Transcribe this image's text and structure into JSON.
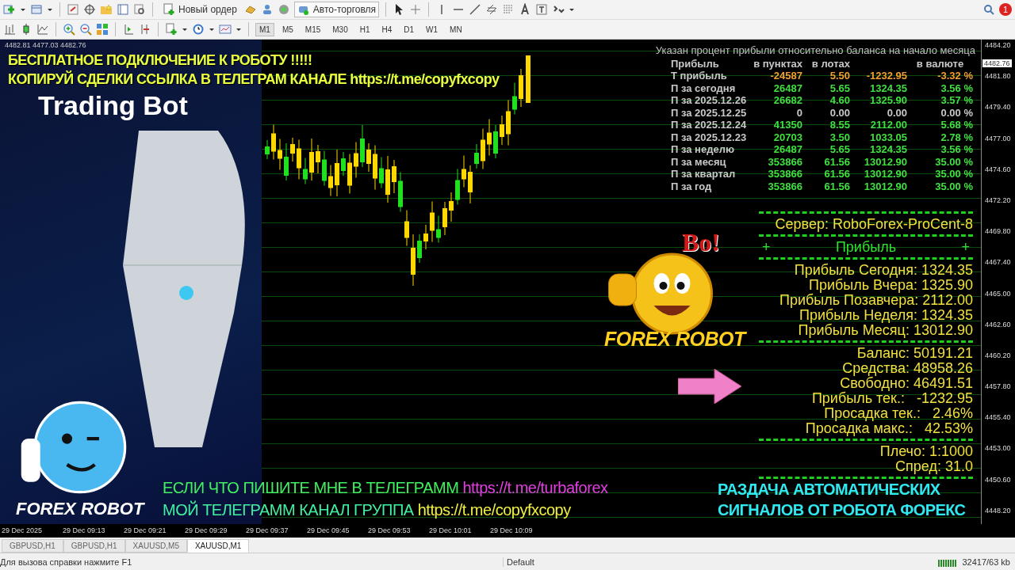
{
  "toolbar": {
    "new_order": "Новый ордер",
    "auto_trading": "Авто-торговля",
    "notifications": "1"
  },
  "periods": [
    {
      "label": "M1",
      "selected": true
    },
    {
      "label": "M5",
      "selected": false
    },
    {
      "label": "M15",
      "selected": false
    },
    {
      "label": "M30",
      "selected": false
    },
    {
      "label": "H1",
      "selected": false
    },
    {
      "label": "H4",
      "selected": false
    },
    {
      "label": "D1",
      "selected": false
    },
    {
      "label": "W1",
      "selected": false
    },
    {
      "label": "MN",
      "selected": false
    }
  ],
  "chart": {
    "ohlc": "4482.81 4477.03 4482.76",
    "banner": [
      "БЕСПЛАТНОЕ ПОДКЛЮЧЕНИЕ К РОБОТУ !!!!!",
      "КОПИРУЙ СДЕЛКИ ССЫЛКА В ТЕЛЕГРАМ КАНАЛЕ https://t.me/copyfxcopy"
    ],
    "picture_title": "Trading Bot",
    "picture_caption": "FOREX ROBOT",
    "sticker": {
      "exclaim": "Bo!",
      "caption": "FOREX ROBOT"
    },
    "profit_table": {
      "note": "Указан процент прибыли относительно баланса на начало месяца",
      "header": {
        "name": "Прибыль",
        "points": "в пунктах",
        "lots": "в лотах",
        "currency": "в валюте"
      },
      "rows": [
        {
          "name": "Т прибыль",
          "points": "-24587",
          "lots": "5.50",
          "money": "-1232.95",
          "percent": "-3.32 %",
          "color": "#f0a030"
        },
        {
          "name": "П за сегодня",
          "points": "26487",
          "lots": "5.65",
          "money": "1324.35",
          "percent": "3.56 %",
          "color": "#40e040"
        },
        {
          "name": "П за 2025.12.26",
          "points": "26682",
          "lots": "4.60",
          "money": "1325.90",
          "percent": "3.57 %",
          "color": "#40e040"
        },
        {
          "name": "П за 2025.12.25",
          "points": "0",
          "lots": "0.00",
          "money": "0.00",
          "percent": "0.00 %",
          "color": "#c8c8c8"
        },
        {
          "name": "П за 2025.12.24",
          "points": "41350",
          "lots": "8.55",
          "money": "2112.00",
          "percent": "5.68 %",
          "color": "#40e040"
        },
        {
          "name": "П за 2025.12.23",
          "points": "20703",
          "lots": "3.50",
          "money": "1033.05",
          "percent": "2.78 %",
          "color": "#40e040"
        },
        {
          "name": "П за неделю",
          "points": "26487",
          "lots": "5.65",
          "money": "1324.35",
          "percent": "3.56 %",
          "color": "#40e040"
        },
        {
          "name": "П за месяц",
          "points": "353866",
          "lots": "61.56",
          "money": "13012.90",
          "percent": "35.00 %",
          "color": "#40e040"
        },
        {
          "name": "П за квартал",
          "points": "353866",
          "lots": "61.56",
          "money": "13012.90",
          "percent": "35.00 %",
          "color": "#40e040"
        },
        {
          "name": "П за год",
          "points": "353866",
          "lots": "61.56",
          "money": "13012.90",
          "percent": "35.00 %",
          "color": "#40e040"
        }
      ]
    },
    "account_panel": {
      "server": "Сервер: RoboForex-ProCent-8",
      "header": {
        "left": "+",
        "title": "Прибыль",
        "right": "+"
      },
      "groups": [
        [
          "Прибыль Сегодня: 1324.35",
          "Прибыль Вчера: 1325.90",
          "Прибыль Позавчера: 2112.00",
          "Прибыль Неделя: 1324.35",
          "Прибыль Месяц: 13012.90"
        ],
        [
          "Баланс: 50191.21",
          "Средства: 48958.26",
          "Свободно: 46491.51",
          "Прибыль тек.:   -1232.95",
          "Просадка тек.:   2.46%",
          "Просадка макс.:   42.53%"
        ],
        [
          "Плечо: 1:1000",
          "Спред: 31.0"
        ]
      ]
    },
    "footer_lines": [
      {
        "text": "ЕСЛИ ЧТО ПИШИТЕ МНЕ В ТЕЛЕГРАММ",
        "link": "https://t.me/turbaforex",
        "kind": "magenta"
      },
      {
        "text": "МОЙ ТЕЛЕГРАММ КАНАЛ ГРУППА",
        "link": "https://t.me/copyfxcopy",
        "kind": "yellow"
      }
    ],
    "signals_note": [
      "РАЗДАЧА АВТОМАТИЧЕСКИХ",
      "СИГНАЛОВ ОТ РОБОТА ФОРЕКС"
    ],
    "price_axis": [
      "4484.20",
      "4481.80",
      "4479.40",
      "4477.00",
      "4474.60",
      "4472.20",
      "4469.80",
      "4467.40",
      "4465.00",
      "4462.60",
      "4460.20",
      "4457.80",
      "4455.40",
      "4453.00",
      "4450.60",
      "4448.20"
    ],
    "price_tag": "4482.76",
    "time_axis": [
      "29 Dec 2025",
      "29 Dec 09:13",
      "29 Dec 09:21",
      "29 Dec 09:29",
      "29 Dec 09:37",
      "29 Dec 09:45",
      "29 Dec 09:53",
      "29 Dec 10:01",
      "29 Dec 10:09"
    ]
  },
  "tabs": [
    {
      "label": "GBPUSD,H1",
      "selected": false
    },
    {
      "label": "GBPUSD,H1",
      "selected": false
    },
    {
      "label": "XAUUSD,M5",
      "selected": false
    },
    {
      "label": "XAUUSD,M1",
      "selected": true
    }
  ],
  "status_bar": {
    "help": "Для вызова справки нажмите F1",
    "profile": "Default",
    "traffic": "32417/63 kb"
  }
}
